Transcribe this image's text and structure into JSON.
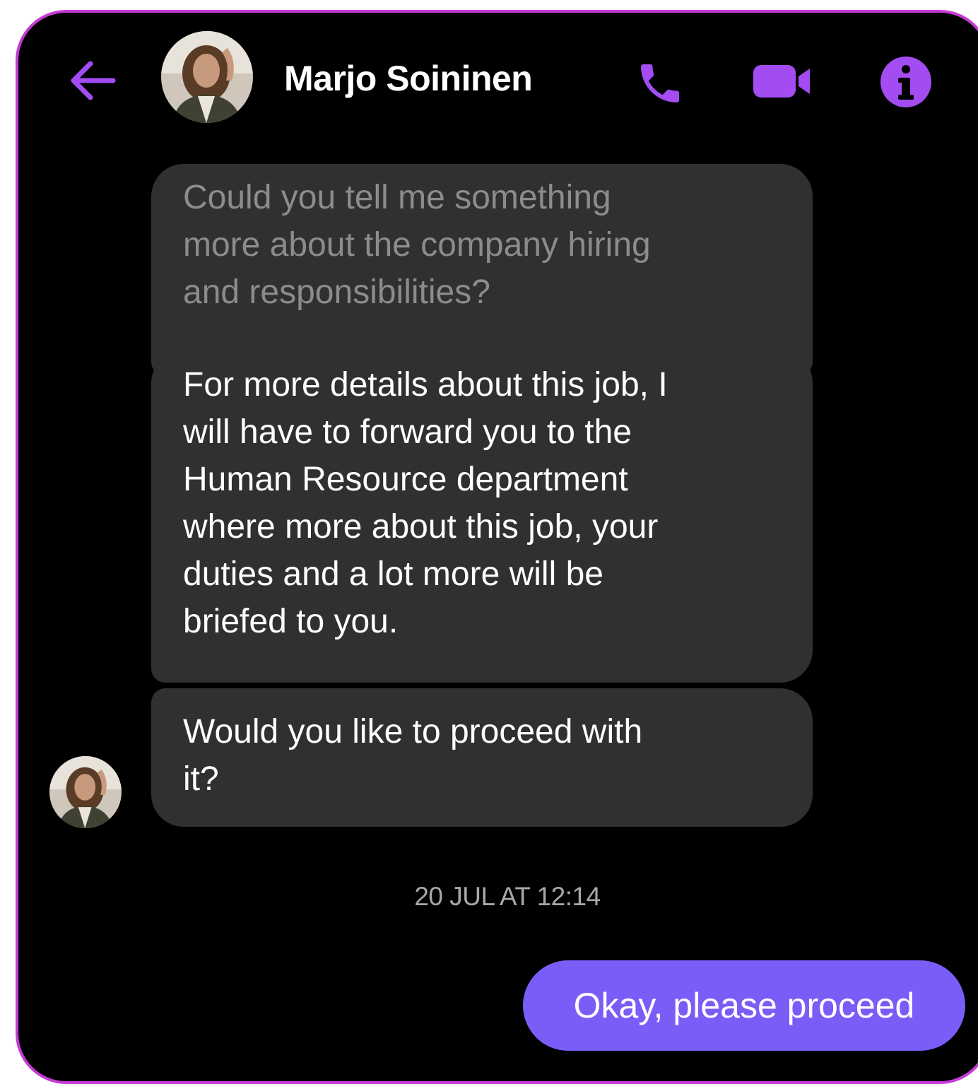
{
  "header": {
    "contact_name": "Marjo Soininen",
    "back_icon": "arrow-left-icon",
    "call_icon": "phone-icon",
    "video_icon": "video-camera-icon",
    "info_icon": "info-icon"
  },
  "messages": {
    "incoming": [
      {
        "lines": [
          "Could you tell me something",
          "more about the company hiring",
          "and responsibilities?"
        ],
        "faded": true
      },
      {
        "lines": [
          "For more details about this job, I",
          "will have to forward you to the",
          "Human Resource department",
          "where more about this job, your",
          "duties and a lot more will be",
          "briefed to you."
        ],
        "faded": false
      },
      {
        "lines": [
          "Would you like to proceed with",
          "it?"
        ],
        "faded": false
      }
    ],
    "timestamp": "20 JUL AT 12:14",
    "outgoing": [
      {
        "text": "Okay, please proceed"
      }
    ]
  },
  "colors": {
    "accent": "#a34cf2",
    "frame_border": "#c63ad6",
    "incoming_bubble": "#303030",
    "outgoing_bubble": "#7a5cf7",
    "background": "#000000"
  }
}
